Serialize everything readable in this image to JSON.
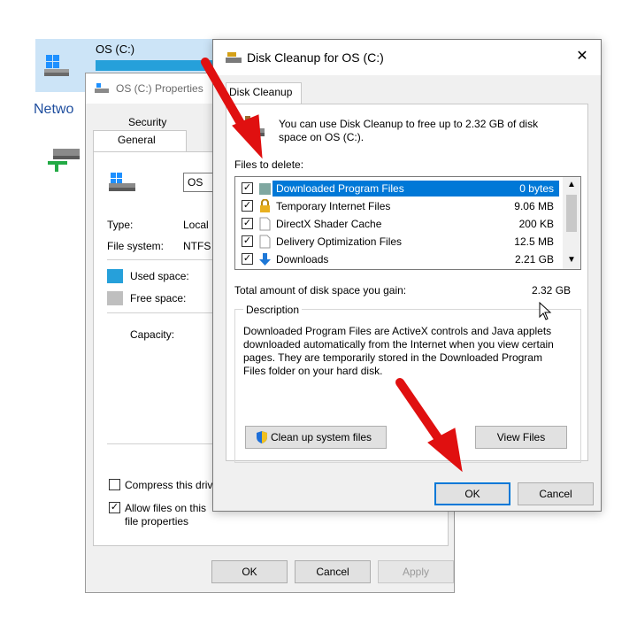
{
  "explorer": {
    "drive_label": "OS (C:)",
    "network_label": "Netwo"
  },
  "properties": {
    "title": "OS (C:) Properties",
    "tabs": {
      "security": "Security",
      "general": "General"
    },
    "name_value": "OS",
    "type_label": "Type:",
    "type_value": "Local",
    "filesystem_label": "File system:",
    "filesystem_value": "NTFS",
    "used_space_label": "Used space:",
    "free_space_label": "Free space:",
    "capacity_label": "Capacity:",
    "compress_label": "Compress this driv",
    "allow_label_1": "Allow files on this",
    "allow_label_2": "file properties",
    "ok": "OK",
    "cancel": "Cancel",
    "apply": "Apply",
    "colors": {
      "used": "#26a0da",
      "free": "#bfbfbf"
    }
  },
  "cleanup": {
    "title": "Disk Cleanup for OS (C:)",
    "close_glyph": "✕",
    "tab": "Disk Cleanup",
    "intro_1": "You can use Disk Cleanup to free up to 2.32 GB of disk",
    "intro_2": "space on OS (C:).",
    "files_to_delete": "Files to delete:",
    "files": [
      {
        "name": "Downloaded Program Files",
        "size": "0 bytes",
        "checked": true,
        "selected": true,
        "icon": "folder-icon"
      },
      {
        "name": "Temporary Internet Files",
        "size": "9.06 MB",
        "checked": true,
        "selected": false,
        "icon": "lock-icon"
      },
      {
        "name": "DirectX Shader Cache",
        "size": "200 KB",
        "checked": true,
        "selected": false,
        "icon": "file-icon"
      },
      {
        "name": "Delivery Optimization Files",
        "size": "12.5 MB",
        "checked": true,
        "selected": false,
        "icon": "file-icon"
      },
      {
        "name": "Downloads",
        "size": "2.21 GB",
        "checked": true,
        "selected": false,
        "icon": "download-arrow-icon"
      }
    ],
    "total_label": "Total amount of disk space you gain:",
    "total_value": "2.32 GB",
    "description_label": "Description",
    "description_lines": [
      "Downloaded Program Files are ActiveX controls and Java applets",
      "downloaded automatically from the Internet when you view certain",
      "pages. They are temporarily stored in the Downloaded Program",
      "Files folder on your hard disk."
    ],
    "clean_system_button": "Clean up system files",
    "view_files_button": "View Files",
    "ok": "OK",
    "cancel": "Cancel",
    "selection_color": "#0078d7"
  }
}
